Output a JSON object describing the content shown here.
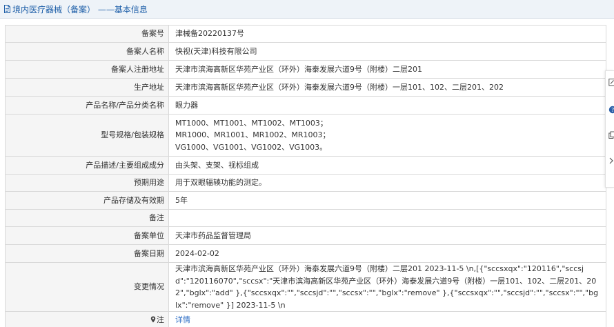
{
  "header": {
    "title": "境内医疗器械（备案） ——基本信息"
  },
  "rows": [
    {
      "label": "备案号",
      "value": "津械备20220137号"
    },
    {
      "label": "备案人名称",
      "value": "快视(天津)科技有限公司"
    },
    {
      "label": "备案人注册地址",
      "value": "天津市滨海高新区华苑产业区（环外）海泰发展六道9号（附楼）二层201"
    },
    {
      "label": "生产地址",
      "value": "天津市滨海高新区华苑产业区（环外）海泰发展六道9号（附楼）一层101、102、二层201、202"
    },
    {
      "label": "产品名称/产品分类名称",
      "value": "眼力器"
    },
    {
      "label": "型号规格/包装规格",
      "lines": [
        "MT1000、MT1001、MT1002、MT1003；",
        "MR1000、MR1001、MR1002、MR1003；",
        "VG1000、VG1001、VG1002、VG1003。"
      ]
    },
    {
      "label": "产品描述/主要组成成分",
      "value": "由头架、支架、视标组成"
    },
    {
      "label": "预期用途",
      "value": "用于双眼辐辏功能的测定。"
    },
    {
      "label": "产品存储及有效期",
      "value": "5年"
    },
    {
      "label": "备注",
      "value": ""
    },
    {
      "label": "备案单位",
      "value": "天津市药品监督管理局"
    },
    {
      "label": "备案日期",
      "value": "2024-02-02"
    },
    {
      "label": "变更情况",
      "value": "天津市滨海高新区华苑产业区（环外）海泰发展六道9号（附楼）二层201 2023-11-5 \\n,[{\"sccsxqx\":\"120116\",\"sccsjd\":\"120116070\",\"sccsx\":\"天津市滨海高新区华苑产业区（环外）海泰发展六道9号（附楼）一层101、102、二层201、202\",\"bglx\":\"add\" },{\"sccsxqx\":\"\",\"sccsjd\":\"\",\"sccsx\":\"\",\"bglx\":\"remove\" },{\"sccsxqx\":\"\",\"sccsjd\":\"\",\"sccsx\":\"\",\"bglx\":\"remove\" }] 2023-11-5 \\n"
    },
    {
      "label": "注",
      "value": "详情"
    }
  ],
  "side_toolbar": {
    "icons": [
      "edit-icon",
      "help-icon",
      "copy-icon",
      "collapse-chevron-icon"
    ]
  },
  "colors": {
    "header_bg": "#eef3f8",
    "header_text": "#1e5fa8",
    "label_bg": "#f5f5f5",
    "border": "#d9d9d9",
    "link": "#2b6cc4"
  }
}
